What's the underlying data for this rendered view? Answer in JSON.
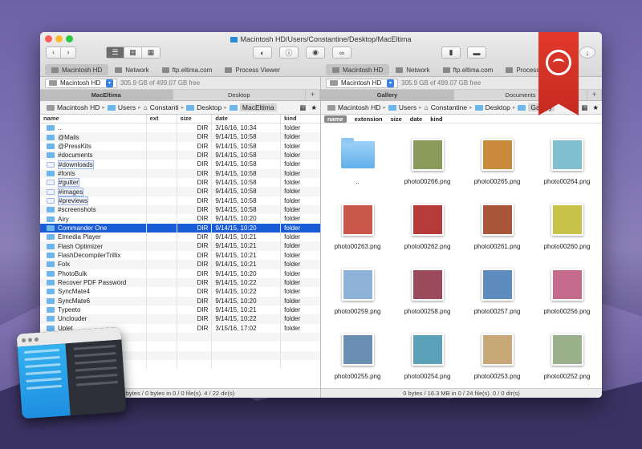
{
  "window": {
    "title": "Macintosh HD/Users/Constantine/Desktop/MacEltima"
  },
  "favorites_left": [
    {
      "label": "Macintosh HD"
    },
    {
      "label": "Network"
    },
    {
      "label": "ftp.eltima.com"
    },
    {
      "label": "Process Viewer"
    }
  ],
  "favorites_right": [
    {
      "label": "Macintosh HD"
    },
    {
      "label": "Network"
    },
    {
      "label": "ftp.eltima.com"
    },
    {
      "label": "Process View"
    }
  ],
  "left": {
    "drive": "Macintosh HD",
    "free": "305.9 GB of 499.07 GB free",
    "tabs": [
      "MacEltima",
      "Desktop"
    ],
    "crumbs": [
      "Macintosh HD",
      "Users",
      "Constanti",
      "Desktop",
      "MacEltima"
    ],
    "columns": {
      "name": "name",
      "ext": "ext",
      "size": "size",
      "date": "date",
      "kind": "kind"
    },
    "rows": [
      {
        "name": "..",
        "size": "DIR",
        "date": "3/16/16, 10:34",
        "kind": "folder"
      },
      {
        "name": "@Mails",
        "size": "DIR",
        "date": "9/14/15, 10:58",
        "kind": "folder"
      },
      {
        "name": "@PressKits",
        "size": "DIR",
        "date": "9/14/15, 10:58",
        "kind": "folder"
      },
      {
        "name": "#documents",
        "size": "DIR",
        "date": "9/14/15, 10:58",
        "kind": "folder"
      },
      {
        "name": "#downloads",
        "size": "DIR",
        "date": "9/14/15, 10:58",
        "kind": "folder",
        "tag": true
      },
      {
        "name": "#fonts",
        "size": "DIR",
        "date": "9/14/15, 10:58",
        "kind": "folder"
      },
      {
        "name": "#gutter",
        "size": "DIR",
        "date": "9/14/15, 10:58",
        "kind": "folder",
        "tag": true
      },
      {
        "name": "#images",
        "size": "DIR",
        "date": "9/14/15, 10:58",
        "kind": "folder",
        "tag": true
      },
      {
        "name": "#previews",
        "size": "DIR",
        "date": "9/14/15, 10:58",
        "kind": "folder",
        "tag": true
      },
      {
        "name": "#screenshots",
        "size": "DIR",
        "date": "9/14/15, 10:58",
        "kind": "folder"
      },
      {
        "name": "Airy",
        "size": "DIR",
        "date": "9/14/15, 10:20",
        "kind": "folder"
      },
      {
        "name": "Commander One",
        "size": "DIR",
        "date": "9/14/15, 10:20",
        "kind": "folder",
        "sel": true
      },
      {
        "name": "Elmedia Player",
        "size": "DIR",
        "date": "9/14/15, 10:21",
        "kind": "folder"
      },
      {
        "name": "Flash Optimizer",
        "size": "DIR",
        "date": "9/14/15, 10:21",
        "kind": "folder"
      },
      {
        "name": "FlashDecompilerTrillix",
        "size": "DIR",
        "date": "9/14/15, 10:21",
        "kind": "folder"
      },
      {
        "name": "Folx",
        "size": "DIR",
        "date": "9/14/15, 10:21",
        "kind": "folder"
      },
      {
        "name": "PhotoBulk",
        "size": "DIR",
        "date": "9/14/15, 10:20",
        "kind": "folder"
      },
      {
        "name": "Recover PDF Password",
        "size": "DIR",
        "date": "9/14/15, 10:22",
        "kind": "folder"
      },
      {
        "name": "SyncMate4",
        "size": "DIR",
        "date": "9/14/15, 10:22",
        "kind": "folder"
      },
      {
        "name": "SyncMate6",
        "size": "DIR",
        "date": "9/14/15, 10:20",
        "kind": "folder"
      },
      {
        "name": "Typeeto",
        "size": "DIR",
        "date": "9/14/15, 10:21",
        "kind": "folder"
      },
      {
        "name": "Unclouder",
        "size": "DIR",
        "date": "9/14/15, 10:22",
        "kind": "folder"
      },
      {
        "name": "Uplet",
        "size": "DIR",
        "date": "3/15/16, 17:02",
        "kind": "folder"
      }
    ],
    "status": "bytes / 0 bytes in 0 / 0 file(s). 4 / 22 dir(s)"
  },
  "right": {
    "drive": "Macintosh HD",
    "free": "305.9 GB of 499.07 GB free",
    "tabs": [
      "Gallery",
      "Documents"
    ],
    "crumbs": [
      "Macintosh HD",
      "Users",
      "Constantine",
      "Desktop",
      "Gallery"
    ],
    "columns": {
      "name": "name",
      "extension": "extension",
      "size": "size",
      "date": "date",
      "kind": "kind"
    },
    "items": [
      {
        "name": "..",
        "color": "#7fc4f2",
        "folder": true
      },
      {
        "name": "photo00266.png",
        "color": "#8a9a5a"
      },
      {
        "name": "photo00265.png",
        "color": "#c98a3e"
      },
      {
        "name": "photo00264.png",
        "color": "#7fbfd0"
      },
      {
        "name": "photo00263.png",
        "color": "#c9574a"
      },
      {
        "name": "photo00262.png",
        "color": "#b63a3a"
      },
      {
        "name": "photo00261.png",
        "color": "#a8563a"
      },
      {
        "name": "photo00260.png",
        "color": "#c8c24a"
      },
      {
        "name": "photo00259.png",
        "color": "#8fb2d8"
      },
      {
        "name": "photo00258.png",
        "color": "#9a4a5a"
      },
      {
        "name": "photo00257.png",
        "color": "#5e8cbf"
      },
      {
        "name": "photo00256.png",
        "color": "#c46a8a"
      },
      {
        "name": "photo00255.png",
        "color": "#6a8fb2"
      },
      {
        "name": "photo00254.png",
        "color": "#5aa0b8"
      },
      {
        "name": "photo00253.png",
        "color": "#c8a878"
      },
      {
        "name": "photo00252.png",
        "color": "#9ab08a"
      }
    ],
    "status": "0 bytes / 16.3 MB in 0 / 24 file(s). 0 / 0 dir(s)"
  }
}
